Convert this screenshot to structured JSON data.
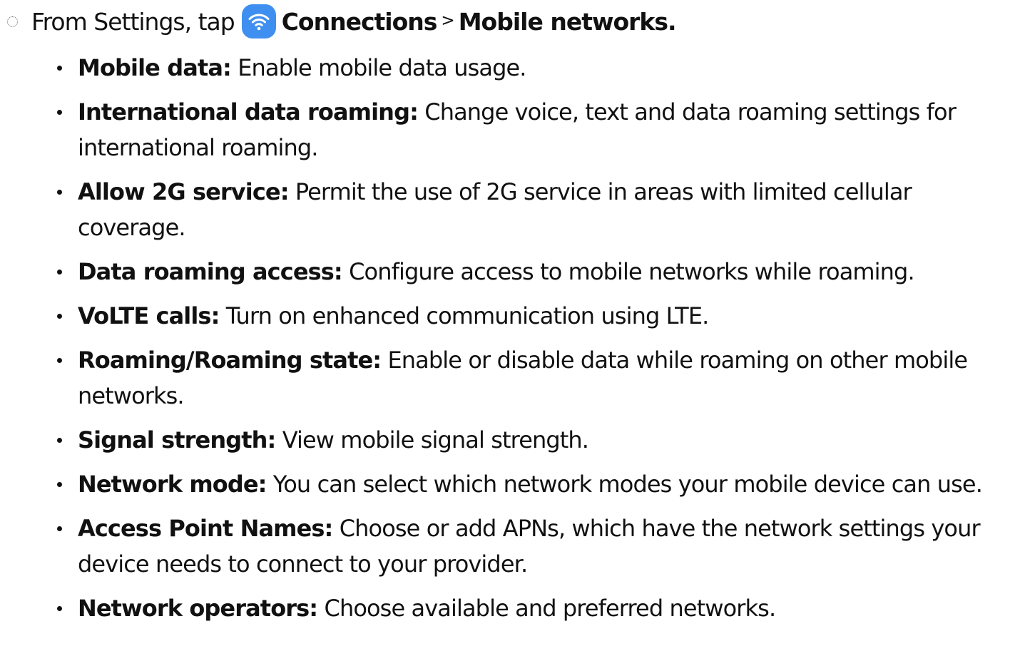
{
  "step": {
    "prefix": "From Settings, tap",
    "app_name": "Connections",
    "separator": ">",
    "screen_name": "Mobile networks.",
    "icon": "wifi-icon",
    "icon_color": "#3f8ff0"
  },
  "items": [
    {
      "term": "Mobile data:",
      "description": "Enable mobile data usage."
    },
    {
      "term": "International data roaming:",
      "description": "Change voice, text and data roaming settings for international roaming."
    },
    {
      "term": "Allow 2G service:",
      "description": "Permit the use of 2G service in areas with limited cellular coverage."
    },
    {
      "term": "Data roaming access:",
      "description": "Configure access to mobile networks while roaming."
    },
    {
      "term": "VoLTE calls:",
      "description": "Turn on enhanced communication using LTE."
    },
    {
      "term": "Roaming/Roaming state:",
      "description": "Enable or disable data while roaming on other mobile networks."
    },
    {
      "term": "Signal strength:",
      "description": "View mobile signal strength."
    },
    {
      "term": "Network mode:",
      "description": "You can select which network modes your mobile device can use."
    },
    {
      "term": "Access Point Names:",
      "description": "Choose or add APNs, which have the network settings your device needs to connect to your provider."
    },
    {
      "term": "Network operators:",
      "description": "Choose available and preferred networks."
    }
  ]
}
